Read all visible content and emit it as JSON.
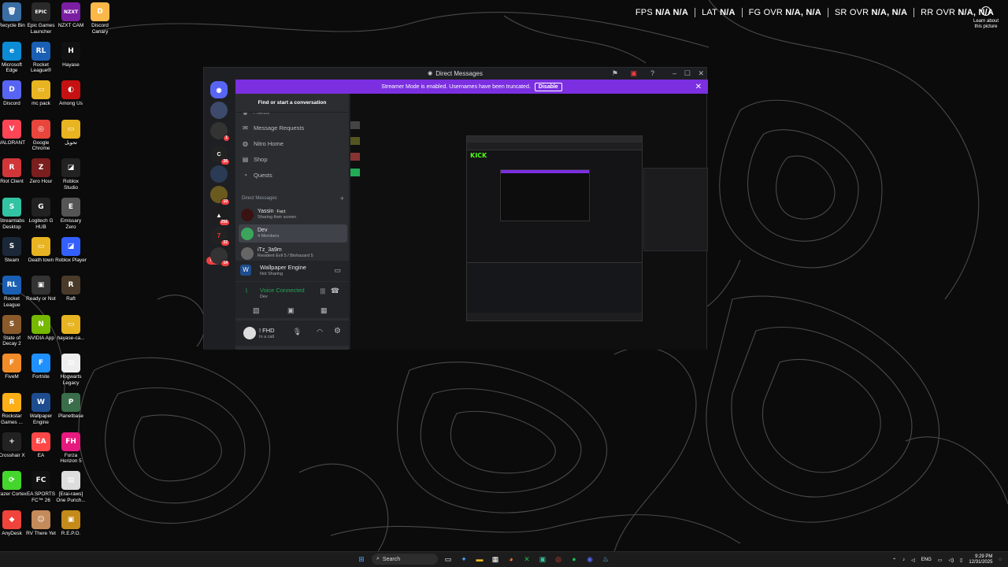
{
  "desktop": {
    "icons": [
      {
        "label": "Recycle Bin",
        "glyph": "🗑",
        "color": "#3a6ea5"
      },
      {
        "label": "Microsoft\nEdge",
        "glyph": "e",
        "color": "#0c8cd6"
      },
      {
        "label": "Discord",
        "glyph": "D",
        "color": "#5865f2"
      },
      {
        "label": "VALORANT",
        "glyph": "V",
        "color": "#fd4556"
      },
      {
        "label": "Riot Client",
        "glyph": "R",
        "color": "#d13639"
      },
      {
        "label": "Streamlabs\nDesktop",
        "glyph": "S",
        "color": "#31c3a2"
      },
      {
        "label": "Steam",
        "glyph": "S",
        "color": "#1b2838"
      },
      {
        "label": "Rocket\nLeague",
        "glyph": "RL",
        "color": "#1a5fb4"
      },
      {
        "label": "State of\nDecay 2",
        "glyph": "S",
        "color": "#8a5a2b"
      },
      {
        "label": "FiveM",
        "glyph": "F",
        "color": "#f28c28"
      },
      {
        "label": "Rockstar\nGames ...",
        "glyph": "R",
        "color": "#fcaf17"
      },
      {
        "label": "Crosshair X",
        "glyph": "+",
        "color": "#222"
      },
      {
        "label": "Razer Cortex",
        "glyph": "⟳",
        "color": "#44d62c"
      },
      {
        "label": "AnyDesk",
        "glyph": "◆",
        "color": "#ef443b"
      },
      {
        "label": "Epic Games\nLauncher",
        "glyph": "EPIC",
        "color": "#2a2a2a"
      },
      {
        "label": "Rocket\nLeague®",
        "glyph": "RL",
        "color": "#1a5fb4"
      },
      {
        "label": "mc pack",
        "glyph": "▭",
        "color": "#e8b422"
      },
      {
        "label": "Google\nChrome",
        "glyph": "◎",
        "color": "#e8453c"
      },
      {
        "label": "Zero Hour",
        "glyph": "Z",
        "color": "#7a1e1e"
      },
      {
        "label": "Logitech G\nHUB",
        "glyph": "G",
        "color": "#222"
      },
      {
        "label": "Death town",
        "glyph": "▭",
        "color": "#e8b422"
      },
      {
        "label": "Ready or Not",
        "glyph": "▣",
        "color": "#333"
      },
      {
        "label": "NVIDIA App",
        "glyph": "N",
        "color": "#76b900"
      },
      {
        "label": "Fortnite",
        "glyph": "F",
        "color": "#1e90ff"
      },
      {
        "label": "Wallpaper\nEngine",
        "glyph": "W",
        "color": "#1d4d8f"
      },
      {
        "label": "EA",
        "glyph": "EA",
        "color": "#ff4747"
      },
      {
        "label": "EA SPORTS\nFC™ 26",
        "glyph": "FC",
        "color": "#111"
      },
      {
        "label": "RV There Yet",
        "glyph": "☺",
        "color": "#c48b5a"
      },
      {
        "label": "NZXT CAM",
        "glyph": "NZXT",
        "color": "#7a1fa2"
      },
      {
        "label": "Hayase",
        "glyph": "H",
        "color": "#111"
      },
      {
        "label": "Among Us",
        "glyph": "◐",
        "color": "#c51111"
      },
      {
        "label": "تحويل",
        "glyph": "▭",
        "color": "#e8b422"
      },
      {
        "label": "Roblox\nStudio",
        "glyph": "◪",
        "color": "#222"
      },
      {
        "label": "Emissary\nZero",
        "glyph": "E",
        "color": "#555"
      },
      {
        "label": "Roblox Player",
        "glyph": "◪",
        "color": "#335fff"
      },
      {
        "label": "Raft",
        "glyph": "R",
        "color": "#4a3a2a"
      },
      {
        "label": "hayase-ca...",
        "glyph": "▭",
        "color": "#e8b422"
      },
      {
        "label": "Hogwarts\nLegacy",
        "glyph": "▤",
        "color": "#eee"
      },
      {
        "label": "Planetbase",
        "glyph": "P",
        "color": "#3a6e4a"
      },
      {
        "label": "Forza\nHorizon 5",
        "glyph": "FH",
        "color": "#e6197e"
      },
      {
        "label": "[Erai-raws]\nOne Punch...",
        "glyph": "▤",
        "color": "#ddd"
      },
      {
        "label": "R.E.P.O.",
        "glyph": "▣",
        "color": "#c48a1a"
      },
      {
        "label": "Discord\nCanary",
        "glyph": "D",
        "color": "#fbb848"
      }
    ]
  },
  "overlay": {
    "fps_label": "FPS",
    "fps_val": "N/A  N/A",
    "lat_label": "LAT",
    "lat_val": "N/A",
    "fg_label": "FG OVR",
    "fg_val": "N/A, N/A",
    "sr_label": "SR OVR",
    "sr_val": "N/A, N/A",
    "rr_label": "RR OVR",
    "rr_val": "N/A, N/A",
    "learn": "Learn about\nthis picture"
  },
  "discord": {
    "title": "Direct Messages",
    "streamer_msg": "Streamer Mode is enabled. Usernames have been truncated.",
    "disable": "Disable",
    "find": "Find or start a conversation",
    "friends": "Friends",
    "nav": [
      "Message Requests",
      "Nitro Home",
      "Shop",
      "Quests"
    ],
    "dm_header": "Direct Messages",
    "dms": [
      {
        "name": "Yassin",
        "tag": "Fact",
        "sub": "Sharing their screen"
      },
      {
        "name": "Dev",
        "sub": "4 Members"
      },
      {
        "name": "iTz_3a9m",
        "sub": "Resident Evil 5 / Biohazard 5"
      }
    ],
    "server_badges": [
      "1",
      "26",
      "10",
      "256",
      "22",
      "14"
    ],
    "new_badge": "NEW",
    "activity": {
      "name": "Wallpaper Engine",
      "status": "Not Sharing"
    },
    "voice": {
      "status": "Voice Connected",
      "channel": "Dev"
    },
    "user": {
      "name": "! FHD",
      "status": "In a call"
    },
    "stream_logo": "KICK"
  },
  "taskbar": {
    "search": "Search",
    "lang": "ENG",
    "time": "9:29 PM",
    "date": "12/31/2025"
  }
}
